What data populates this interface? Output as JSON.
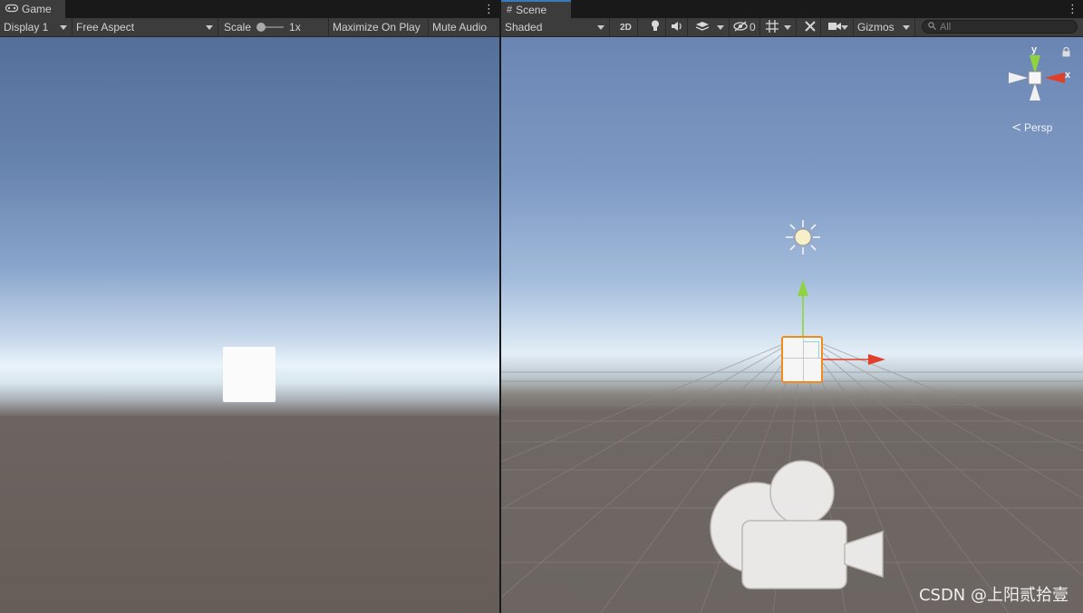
{
  "game": {
    "tab_label": "Game",
    "toolbar": {
      "display": "Display 1",
      "aspect": "Free Aspect",
      "scale_label": "Scale",
      "scale_value": "1x",
      "maximize": "Maximize On Play",
      "mute": "Mute Audio"
    }
  },
  "scene": {
    "tab_label": "Scene",
    "toolbar": {
      "shading": "Shaded",
      "mode_2d": "2D",
      "hidden_count": "0",
      "gizmos": "Gizmos",
      "search_placeholder": "All"
    },
    "gizmo": {
      "y_label": "y",
      "x_label": "x",
      "projection": "Persp"
    }
  },
  "watermark": "CSDN @上阳贰拾壹",
  "colors": {
    "tab_highlight": "#3a79bb",
    "axis_x": "#e0402a",
    "axis_y": "#8fd43e",
    "selection": "#f28a1c"
  }
}
